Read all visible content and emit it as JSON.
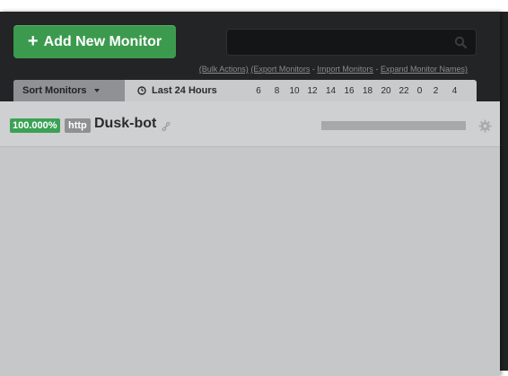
{
  "toolbar": {
    "add_plus": "+",
    "add_label": "Add New Monitor",
    "search_placeholder": "",
    "links": [
      "(Bulk Actions)",
      "(Export Monitors",
      "Import Monitors",
      "Expand Monitor Names)"
    ],
    "link_separator": "-"
  },
  "header": {
    "sort_label": "Sort Monitors",
    "range_label": "Last 24 Hours",
    "hours": [
      "6",
      "8",
      "10",
      "12",
      "14",
      "16",
      "18",
      "20",
      "22",
      "0",
      "2",
      "4"
    ]
  },
  "monitors": [
    {
      "uptime": "100.000%",
      "type": "http",
      "name": "Dusk-bot"
    }
  ],
  "colors": {
    "accent_green": "#3c9a4e",
    "uptime_green": "#3ba154",
    "dark_panel": "#222426"
  }
}
